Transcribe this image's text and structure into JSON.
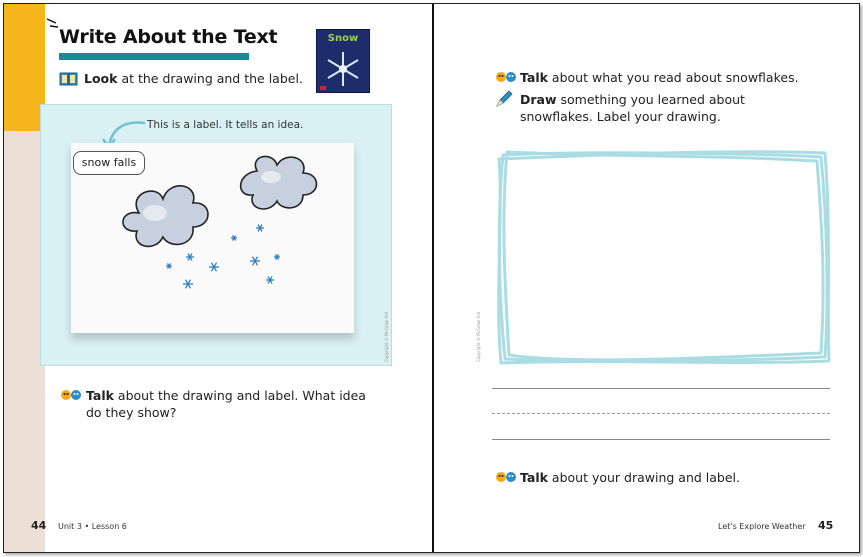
{
  "left_page": {
    "title": "Write About the Text",
    "book_cover_title": "Snow",
    "look_instruction": {
      "bold": "Look",
      "rest": " at the drawing and the label."
    },
    "label_note": "This is a label. It tells an idea.",
    "drawing_label": "snow falls",
    "talk_instruction": {
      "bold": "Talk",
      "rest": " about the drawing and label. What idea do they show?"
    },
    "copyright": "Copyright © McGraw Hill",
    "page_number": "44",
    "footer": "Unit 3 • Lesson 6"
  },
  "right_page": {
    "talk_instruction_1": {
      "bold": "Talk",
      "rest": " about what you read about snowflakes."
    },
    "draw_instruction": {
      "bold": "Draw",
      "rest": " something you learned about snowflakes. Label your drawing."
    },
    "talk_instruction_2": {
      "bold": "Talk",
      "rest": " about your drawing and label."
    },
    "copyright": "Copyright © McGraw Hill",
    "footer": "Let's Explore Weather",
    "page_number": "45"
  },
  "colors": {
    "accent_yellow": "#f6b51a",
    "side_tan": "#ecdfd6",
    "title_bar_teal": "#1a8a96",
    "frame_blue": "#a9dde3",
    "snowflake_blue": "#2f7fc2"
  }
}
